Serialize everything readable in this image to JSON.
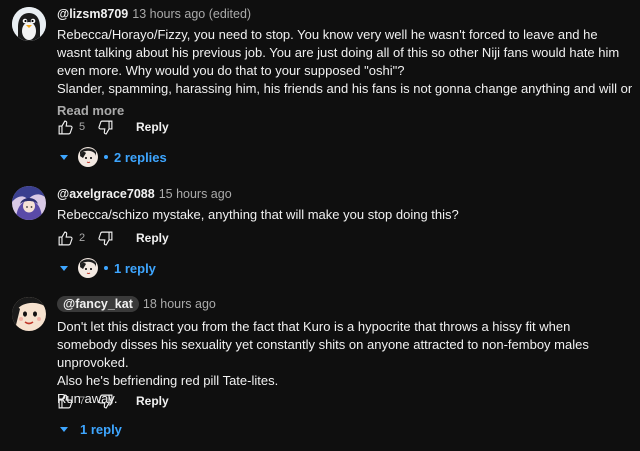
{
  "colors": {
    "background": "#0f0f0f",
    "text": "#f1f1f1",
    "muted": "#aaaaaa",
    "link": "#3ea6ff"
  },
  "comments": [
    {
      "author": "@lizsm8709",
      "time": "13 hours ago (edited)",
      "lines": [
        "Rebecca/Horayo/Fizzy, you need to stop. You know very well he wasn't forced to leave and he wasnt talking about his previous job. You are just doing all of this so other Niji fans would hate him even more. Why would you do that to your supposed \"oshi\"?",
        "Slander, spamming, harassing him, his friends and his fans is not gonna change anything and will only make .."
      ],
      "read_more": "Read more",
      "likes": "5",
      "reply_label": "Reply",
      "replies_label": "2 replies",
      "avatar_icon": "penguin-avatar"
    },
    {
      "author": "@axelgrace7088",
      "time": "15 hours ago",
      "lines": [
        "Rebecca/schizo mystake, anything that will make you stop doing this?"
      ],
      "likes": "2",
      "reply_label": "Reply",
      "replies_label": "1 reply",
      "avatar_icon": "anime-avatar"
    },
    {
      "author": "@fancy_kat",
      "time": "18 hours ago",
      "lines": [
        "Don't let this distract you from the fact that Kuro is a hypocrite that throws a hissy fit when somebody disses his sexuality yet constantly shits on anyone attracted to non-femboy males unprovoked.",
        "Also he's befriending red pill Tate-lites.",
        "Run away."
      ],
      "likes": "7",
      "reply_label": "Reply",
      "replies_label": "1 reply",
      "avatar_icon": "cartoon-face-avatar"
    }
  ]
}
